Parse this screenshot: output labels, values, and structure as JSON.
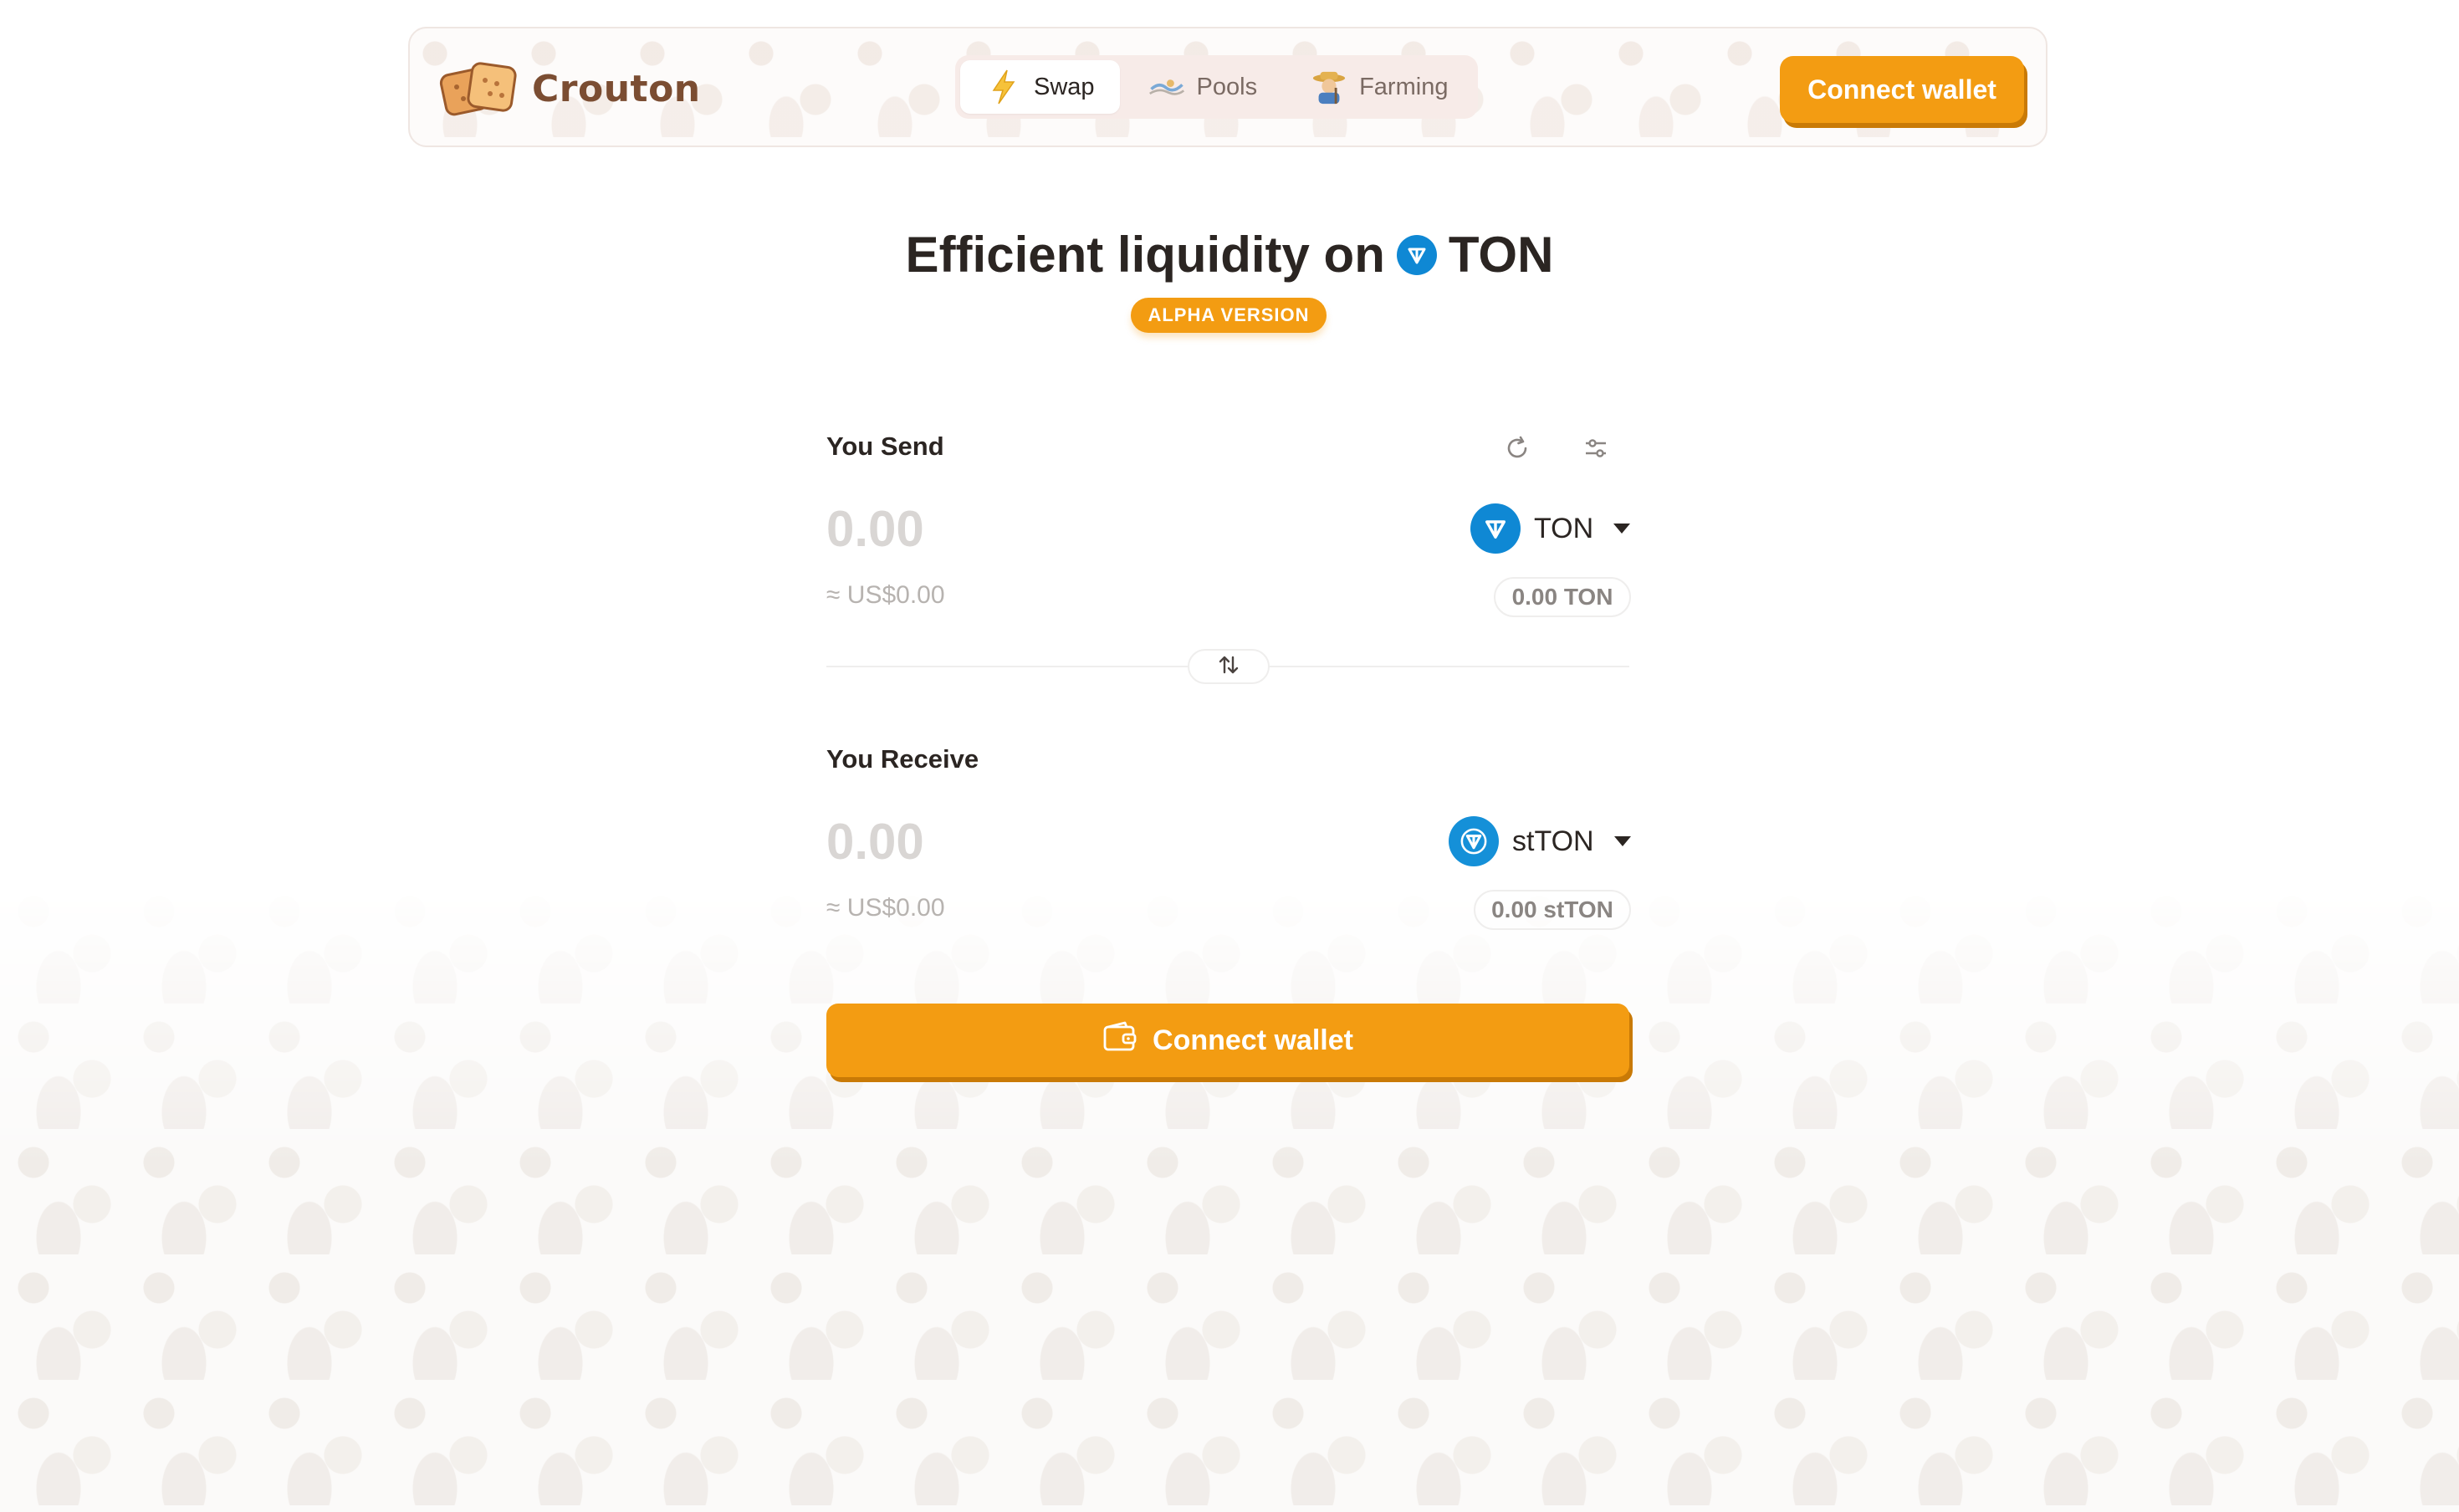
{
  "brand": {
    "name": "Crouton"
  },
  "nav": {
    "tabs": [
      {
        "label": "Swap",
        "icon": "lightning-icon",
        "active": true
      },
      {
        "label": "Pools",
        "icon": "pool-icon",
        "active": false
      },
      {
        "label": "Farming",
        "icon": "farmer-icon",
        "active": false
      }
    ]
  },
  "header": {
    "connect_label": "Connect wallet"
  },
  "hero": {
    "title_prefix": "Efficient liquidity on",
    "title_token": "TON",
    "badge": "ALPHA VERSION"
  },
  "swap": {
    "send": {
      "label": "You Send",
      "amount_placeholder": "0.00",
      "usd": "≈ US$0.00",
      "token": "TON",
      "balance": "0.00 TON"
    },
    "receive": {
      "label": "You Receive",
      "amount_placeholder": "0.00",
      "usd": "≈ US$0.00",
      "token": "stTON",
      "balance": "0.00 stTON"
    },
    "connect_label": "Connect wallet"
  },
  "colors": {
    "accent": "#f39c12",
    "accent_shadow": "#c97a06",
    "ton_blue": "#0f88d4",
    "brand_brown": "#7b4d32"
  }
}
